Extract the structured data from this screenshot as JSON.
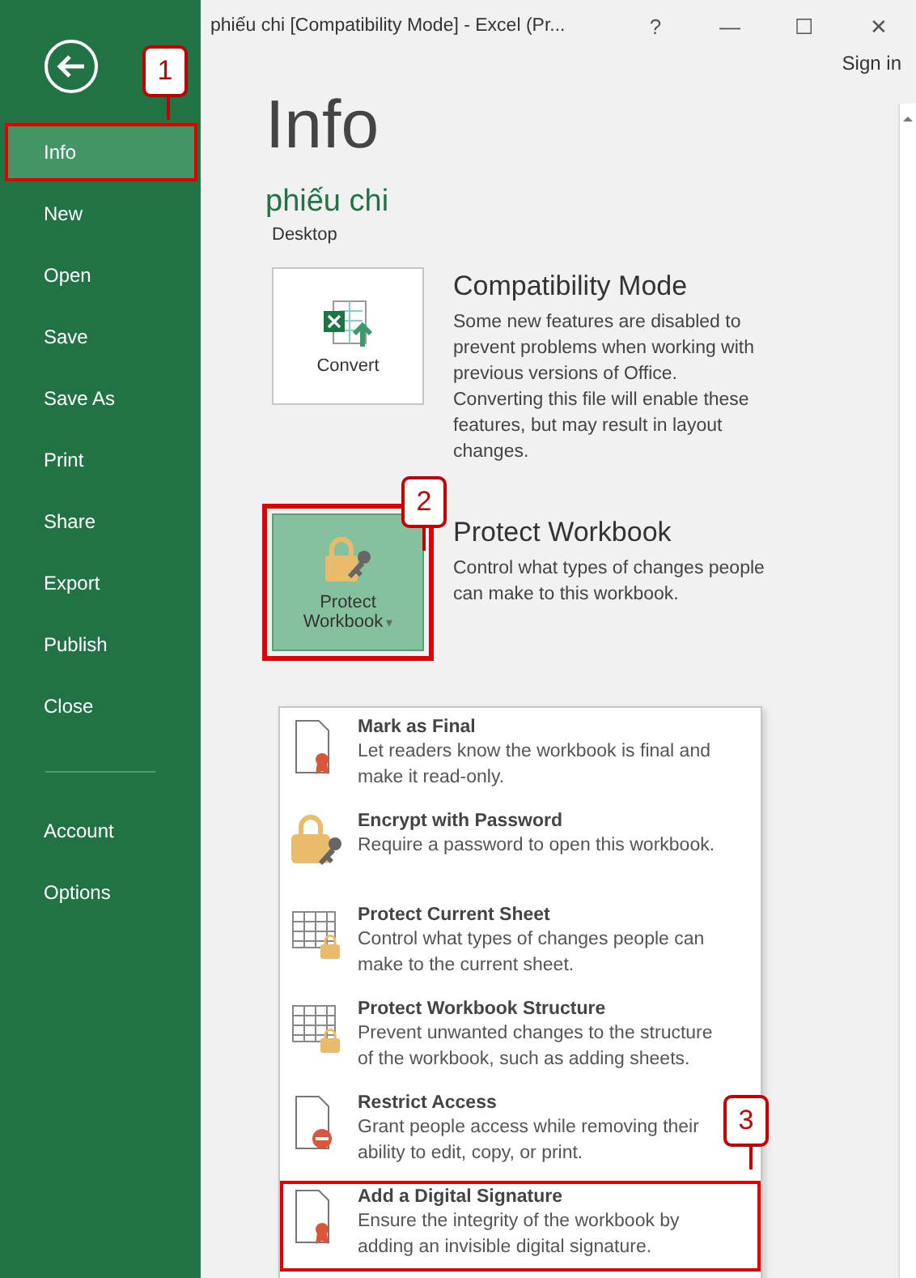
{
  "window": {
    "title": "phiếu chi  [Compatibility Mode] - Excel (Pr...",
    "controls": [
      "?",
      "—",
      "☐",
      "✕"
    ],
    "sign_in": "Sign in"
  },
  "sidebar": {
    "items": [
      {
        "label": "Info",
        "selected": true,
        "separator_before": false
      },
      {
        "label": "New",
        "selected": false,
        "separator_before": false
      },
      {
        "label": "Open",
        "selected": false,
        "separator_before": false
      },
      {
        "label": "Save",
        "selected": false,
        "separator_before": false
      },
      {
        "label": "Save As",
        "selected": false,
        "separator_before": false
      },
      {
        "label": "Print",
        "selected": false,
        "separator_before": false
      },
      {
        "label": "Share",
        "selected": false,
        "separator_before": false
      },
      {
        "label": "Export",
        "selected": false,
        "separator_before": false
      },
      {
        "label": "Publish",
        "selected": false,
        "separator_before": false
      },
      {
        "label": "Close",
        "selected": false,
        "separator_before": false
      },
      {
        "label": "Account",
        "selected": false,
        "separator_before": true
      },
      {
        "label": "Options",
        "selected": false,
        "separator_before": false
      }
    ]
  },
  "page": {
    "heading": "Info",
    "file_name": "phiếu chi",
    "location": "Desktop"
  },
  "sections": [
    {
      "kind": "convert",
      "button": "Convert",
      "title": "Compatibility Mode",
      "description": "Some new features are disabled to prevent problems when working with previous versions of Office. Converting this file will enable these features, but may result in layout changes.",
      "selected": false
    },
    {
      "kind": "protect",
      "button": "Protect Workbook",
      "caret": "▾",
      "title": "Protect Workbook",
      "description": "Control what types of changes people can make to this workbook.",
      "selected": true
    }
  ],
  "menu": {
    "items": [
      {
        "kind": "final",
        "title": "Mark as Final",
        "description": "Let readers know the workbook is final and make it read-only.",
        "selected": false
      },
      {
        "kind": "encrypt",
        "title": "Encrypt with Password",
        "description": "Require a password to open this workbook.",
        "selected": false
      },
      {
        "kind": "sheet",
        "title": "Protect Current Sheet",
        "description": "Control what types of changes people can make to the current sheet.",
        "selected": false
      },
      {
        "kind": "structure",
        "title": "Protect Workbook Structure",
        "description": "Prevent unwanted changes to the structure of the workbook, such as adding sheets.",
        "selected": false
      },
      {
        "kind": "restrict",
        "title": "Restrict Access",
        "description": "Grant people access while removing their ability to edit, copy, or print.",
        "selected": false
      },
      {
        "kind": "signature",
        "title": "Add a Digital Signature",
        "description": "Ensure the integrity of the workbook by adding an invisible digital signature.",
        "selected": true
      }
    ]
  },
  "callouts": [
    "1",
    "2",
    "3"
  ]
}
